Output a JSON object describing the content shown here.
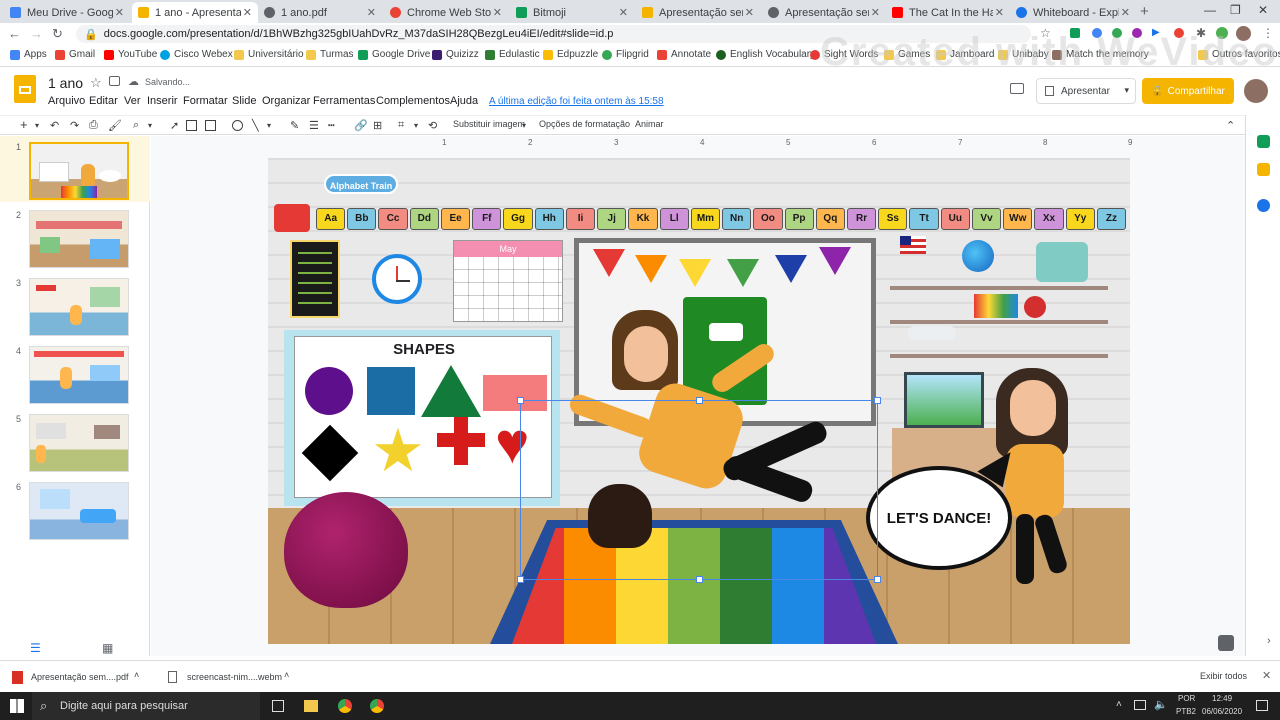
{
  "browser": {
    "tabs": [
      {
        "title": "Meu Drive - Google Drive",
        "color": "#4285f4"
      },
      {
        "title": "1 ano - Apresentações Google",
        "color": "#f4b400"
      },
      {
        "title": "1 ano.pdf",
        "color": "#5f6368"
      },
      {
        "title": "Chrome Web Store - bitmoji",
        "color": "#ea4335"
      },
      {
        "title": "Bitmoji",
        "color": "#0f9d58"
      },
      {
        "title": "Apresentação sem título",
        "color": "#f4b400"
      },
      {
        "title": "Apresentação sem título",
        "color": "#5f6368"
      },
      {
        "title": "The Cat In the Hat by Dr. Seuss",
        "color": "#ff0000"
      },
      {
        "title": "Whiteboard - Explain Everything",
        "color": "#1a73e8"
      }
    ],
    "url": "docs.google.com/presentation/d/1BhWBzhg325gbIUahDvRz_M37daSIH28QBezgLeu4iEI/edit#slide=id.p",
    "bookmarks": [
      "Apps",
      "Gmail",
      "YouTube",
      "Cisco Webex",
      "Universitário",
      "Turmas",
      "Google Drive",
      "Quizizz",
      "Edulastic",
      "Edpuzzle",
      "Flipgrid",
      "Annotate",
      "English Vocabulary",
      "Sight Words",
      "Games",
      "Jamboard",
      "Unibaby",
      "Match the memory"
    ],
    "bookmarks_right": "Outros favoritos"
  },
  "doc": {
    "title": "1 ano",
    "saving": "Salvando...",
    "menus": [
      "Arquivo",
      "Editar",
      "Ver",
      "Inserir",
      "Formatar",
      "Slide",
      "Organizar",
      "Ferramentas",
      "Complementos",
      "Ajuda"
    ],
    "last_edit": "A última edição foi feita ontem às 15:58",
    "present": "Apresentar",
    "share": "Compartilhar"
  },
  "toolbar": {
    "replace_image": "Substituir imagem",
    "format_options": "Opções de formatação",
    "animate": "Animar"
  },
  "ruler": [
    "1",
    "2",
    "3",
    "4",
    "5",
    "6",
    "7",
    "8",
    "9"
  ],
  "slides": [
    1,
    2,
    3,
    4,
    5,
    6
  ],
  "slide": {
    "banner": "Alphabet Train",
    "letters": [
      "Aa",
      "Bb",
      "Cc",
      "Dd",
      "Ee",
      "Ff",
      "Gg",
      "Hh",
      "Ii",
      "Jj",
      "Kk",
      "Ll",
      "Mm",
      "Nn",
      "Oo",
      "Pp",
      "Qq",
      "Rr",
      "Ss",
      "Tt",
      "Uu",
      "Vv",
      "Ww",
      "Xx",
      "Yy",
      "Zz"
    ],
    "calendar_title": "May",
    "shapes_title": "SHAPES",
    "speech": "LET'S DANCE!"
  },
  "downloads": {
    "items": [
      "Apresentação sem....pdf",
      "screencast-nim....webm"
    ],
    "show_all": "Exibir todos"
  },
  "taskbar": {
    "search": "Digite aqui para pesquisar",
    "lang": "POR",
    "layout": "PTB2",
    "time": "12:49",
    "date": "06/06/2020"
  },
  "watermark": "Created with WeVideo",
  "colors": {
    "accent": "#f4b400",
    "chrome": "#dee1e6"
  }
}
